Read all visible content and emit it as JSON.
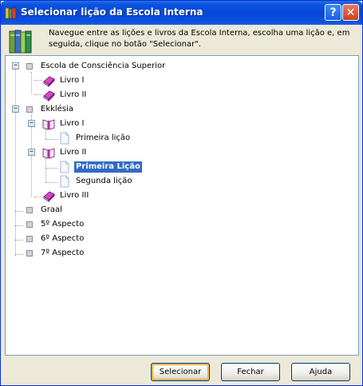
{
  "window": {
    "title": "Selecionar lição da Escola Interna",
    "help_label": "?",
    "close_label": "✕"
  },
  "header": {
    "instructions": "Navegue entre as lições e livros da Escola Interna, escolha uma lição e, em seguida, clique no botão \"Selecionar\"."
  },
  "tree": {
    "nodes": [
      {
        "label": "Escola de Consciência Superior",
        "icon": "square-bullet-icon",
        "expanded": true
      },
      {
        "label": "Livro I",
        "icon": "closed-book-icon"
      },
      {
        "label": "Livro II",
        "icon": "closed-book-icon"
      },
      {
        "label": "Ekklésia",
        "icon": "square-bullet-icon",
        "expanded": true
      },
      {
        "label": "Livro I",
        "icon": "open-book-icon",
        "expanded": true
      },
      {
        "label": "Primeira lição",
        "icon": "page-icon"
      },
      {
        "label": "Livro II",
        "icon": "open-book-icon",
        "expanded": true
      },
      {
        "label": "Primeira Lição",
        "icon": "page-icon",
        "selected": true
      },
      {
        "label": "Segunda lição",
        "icon": "page-icon"
      },
      {
        "label": "Livro III",
        "icon": "closed-book-icon"
      },
      {
        "label": "Graal",
        "icon": "square-bullet-icon"
      },
      {
        "label": "5º Aspecto",
        "icon": "square-bullet-icon"
      },
      {
        "label": "6º Aspecto",
        "icon": "square-bullet-icon"
      },
      {
        "label": "7º Aspecto",
        "icon": "square-bullet-icon"
      }
    ]
  },
  "buttons": {
    "select": "Selecionar",
    "close": "Fechar",
    "help": "Ajuda"
  },
  "colors": {
    "titlebar": "#0a54e0",
    "selection": "#316ac5",
    "book": "#c040c0"
  }
}
